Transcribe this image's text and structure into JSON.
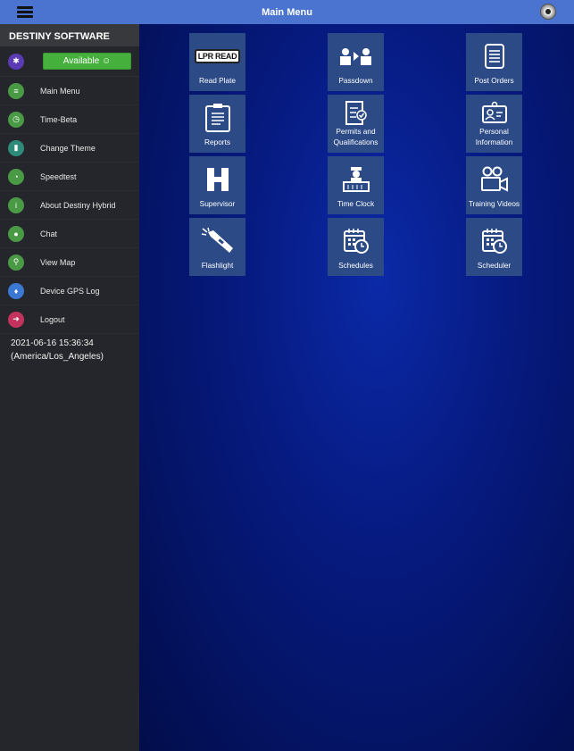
{
  "header": {
    "title": "Main Menu"
  },
  "sidebar": {
    "title": "DESTINY SOFTWARE",
    "status_label": "Available ☺",
    "items": [
      {
        "label": "Main Menu",
        "icon": "list-icon",
        "color": "#4a9a45",
        "glyph": "≡"
      },
      {
        "label": "Time-Beta",
        "icon": "clock-icon",
        "color": "#4a9a45",
        "glyph": "◷"
      },
      {
        "label": "Change Theme",
        "icon": "file-icon",
        "color": "#2e8b7a",
        "glyph": "▮"
      },
      {
        "label": "Speedtest",
        "icon": "speedometer-icon",
        "color": "#4a9a45",
        "glyph": "◔"
      },
      {
        "label": "About Destiny Hybrid",
        "icon": "info-icon",
        "color": "#4a9a45",
        "glyph": "i"
      },
      {
        "label": "Chat",
        "icon": "chat-icon",
        "color": "#4a9a45",
        "glyph": "●"
      },
      {
        "label": "View Map",
        "icon": "map-pin-icon",
        "color": "#4a9a45",
        "glyph": "⚲"
      },
      {
        "label": "Device GPS Log",
        "icon": "pin-icon",
        "color": "#3a78d4",
        "glyph": "♦"
      },
      {
        "label": "Logout",
        "icon": "logout-icon",
        "color": "#c4335e",
        "glyph": "➜"
      }
    ],
    "datetime": "2021-06-16 15:36:34",
    "timezone": "(America/Los_Angeles)"
  },
  "tiles": [
    {
      "label": "Read Plate",
      "icon": "lpr-plate-icon",
      "plate_text": "LPR READ"
    },
    {
      "label": "Passdown",
      "icon": "passdown-icon"
    },
    {
      "label": "Post Orders",
      "icon": "list-document-icon"
    },
    {
      "label": "Reports",
      "icon": "clipboard-icon"
    },
    {
      "label": "Permits and Qualifications",
      "icon": "checklist-icon"
    },
    {
      "label": "Personal Information",
      "icon": "id-badge-icon"
    },
    {
      "label": "Supervisor",
      "icon": "supervisor-icon"
    },
    {
      "label": "Time Clock",
      "icon": "time-clock-icon"
    },
    {
      "label": "Training Videos",
      "icon": "video-camera-icon"
    },
    {
      "label": "Flashlight",
      "icon": "flashlight-icon"
    },
    {
      "label": "Schedules",
      "icon": "calendar-clock-icon"
    },
    {
      "label": "Scheduler",
      "icon": "calendar-clock-icon"
    }
  ]
}
